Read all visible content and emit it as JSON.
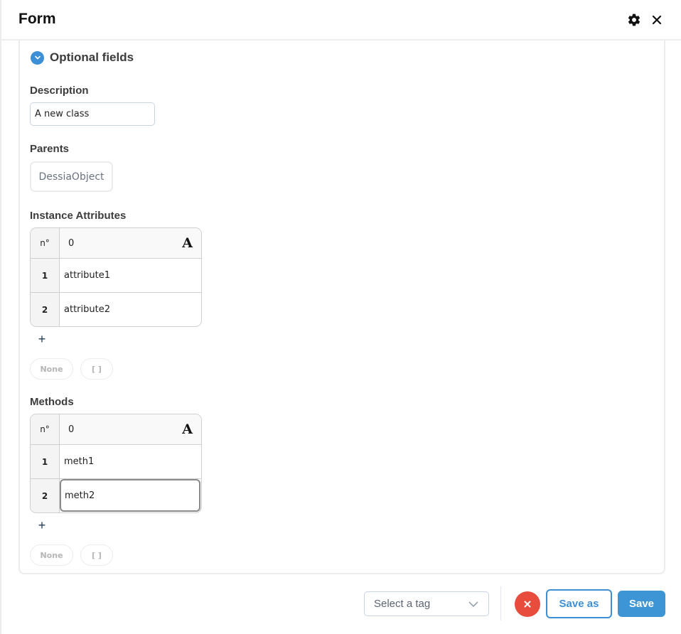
{
  "header": {
    "title": "Form",
    "settings_icon": "gear-icon",
    "close_icon": "close-icon"
  },
  "optional_section": {
    "label": "Optional fields",
    "expanded": true,
    "toggle_icon": "chevron-down-circle-icon"
  },
  "description": {
    "label": "Description",
    "value": "A new class"
  },
  "parents": {
    "label": "Parents",
    "items": [
      "DessiaObject"
    ]
  },
  "instance_attributes": {
    "label": "Instance Attributes",
    "header": {
      "index_label": "n°",
      "column_label": "0",
      "type_icon": "A"
    },
    "rows": [
      {
        "index": "1",
        "value": "attribute1"
      },
      {
        "index": "2",
        "value": "attribute2"
      }
    ],
    "add_label": "+",
    "none_label": "None",
    "empty_list_label": "[ ]"
  },
  "methods": {
    "label": "Methods",
    "header": {
      "index_label": "n°",
      "column_label": "0",
      "type_icon": "A"
    },
    "rows": [
      {
        "index": "1",
        "value": "meth1"
      },
      {
        "index": "2",
        "value": "meth2"
      }
    ],
    "focused_row": 2,
    "add_label": "+",
    "none_label": "None",
    "empty_list_label": "[ ]"
  },
  "footer": {
    "tag_select_placeholder": "Select a tag",
    "cancel_icon": "close-icon",
    "save_as_label": "Save as",
    "save_label": "Save"
  },
  "colors": {
    "accent": "#3d8fd6",
    "danger": "#e74c3c"
  }
}
